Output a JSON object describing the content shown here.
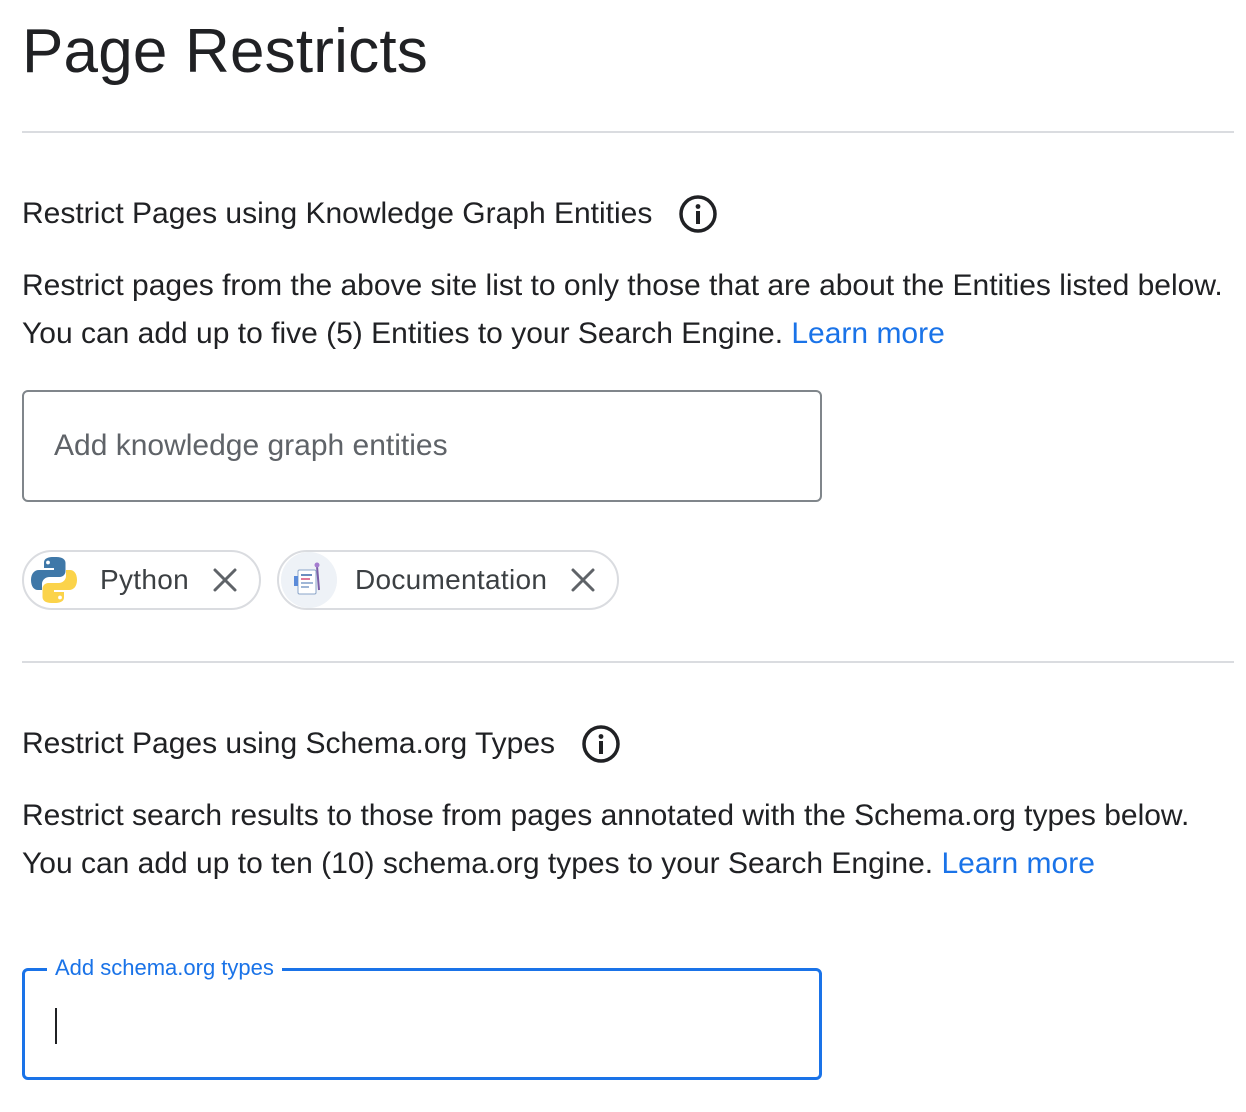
{
  "page": {
    "title": "Page Restricts"
  },
  "kg_section": {
    "title": "Restrict Pages using Knowledge Graph Entities",
    "info_icon": "info-icon",
    "description": "Restrict pages from the above site list to only those that are about the Entities listed below. You can add up to five (5) Entities to your Search Engine.",
    "learn_more": "Learn more",
    "input": {
      "placeholder": "Add knowledge graph entities",
      "value": ""
    },
    "chips": [
      {
        "label": "Python",
        "icon": "python-logo-icon",
        "remove_icon": "close-icon"
      },
      {
        "label": "Documentation",
        "icon": "documentation-image-icon",
        "remove_icon": "close-icon"
      }
    ]
  },
  "schema_section": {
    "title": "Restrict Pages using Schema.org Types",
    "info_icon": "info-icon",
    "description": "Restrict search results to those from pages annotated with the Schema.org types below. You can add up to ten (10) schema.org types to your Search Engine.",
    "learn_more": "Learn more",
    "input": {
      "label": "Add schema.org types",
      "value": "",
      "state": "focused"
    }
  },
  "colors": {
    "link": "#1a73e8",
    "focus": "#1a73e8",
    "divider": "#dadce0",
    "text": "#202124"
  }
}
